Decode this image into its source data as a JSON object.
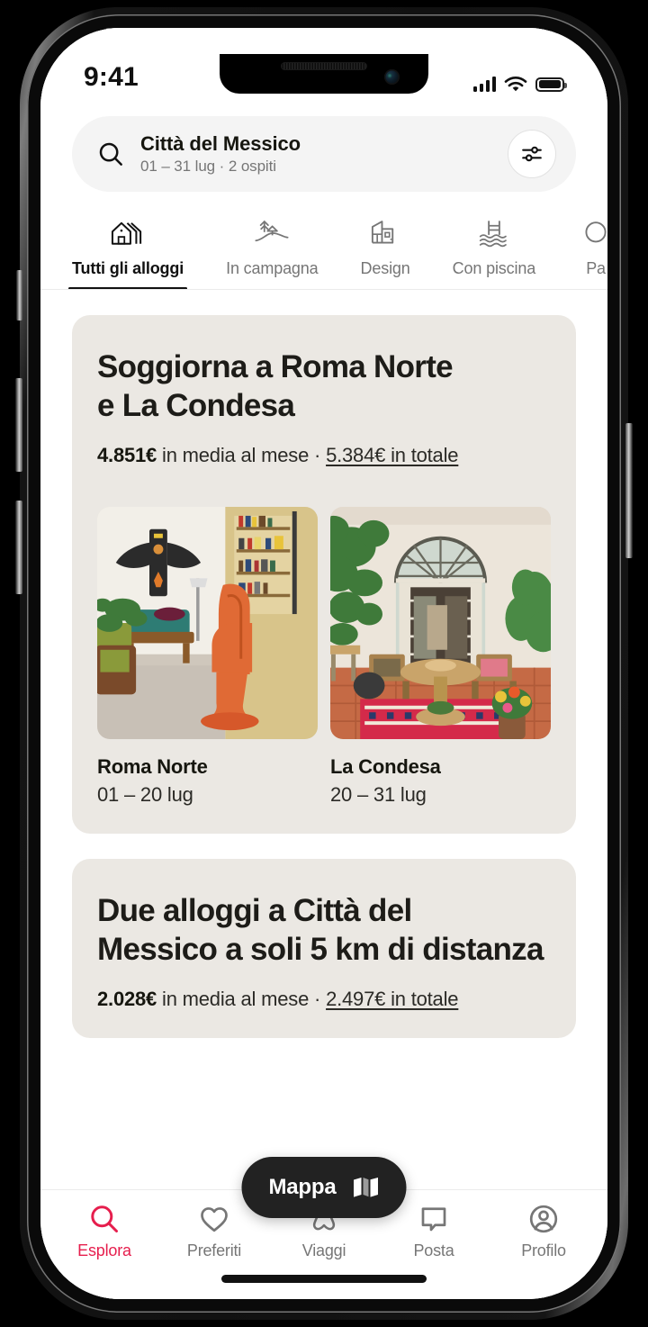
{
  "status_bar": {
    "time": "9:41",
    "signal_icon": "cellular-bars-icon",
    "wifi_icon": "wifi-icon",
    "battery_icon": "battery-full-icon"
  },
  "search": {
    "icon": "search-icon",
    "location": "Città del Messico",
    "details": "01 – 31 lug · 2 ospiti",
    "filter_icon": "filter-sliders-icon"
  },
  "categories": [
    {
      "label": "Tutti gli alloggi",
      "icon": "houses-icon",
      "active": true
    },
    {
      "label": "In campagna",
      "icon": "countryside-icon",
      "active": false
    },
    {
      "label": "Design",
      "icon": "design-building-icon",
      "active": false
    },
    {
      "label": "Con piscina",
      "icon": "pool-icon",
      "active": false
    },
    {
      "label": "Pa",
      "icon": "partial-category-icon",
      "active": false
    }
  ],
  "cards": [
    {
      "title": "Soggiorna a Roma Norte\ne La Condesa",
      "price_amount": "4.851€",
      "price_middle": " in media al mese · ",
      "price_total": "5.384€ in totale",
      "stays": [
        {
          "name": "Roma Norte",
          "dates": "01 – 20 lug",
          "photo": "living-room-orange-chair-photo"
        },
        {
          "name": "La Condesa",
          "dates": "20 – 31 lug",
          "photo": "courtyard-arched-doors-photo"
        }
      ]
    },
    {
      "title": "Due alloggi a Città del\nMessico a soli 5 km di distanza",
      "price_amount": "2.028€",
      "price_middle": " in media al mese · ",
      "price_total": "2.497€ in totale",
      "stays": []
    }
  ],
  "map_pill": {
    "label": "Mappa",
    "icon": "map-folded-icon"
  },
  "bottom_nav": [
    {
      "label": "Esplora",
      "icon": "search-icon",
      "active": true
    },
    {
      "label": "Preferiti",
      "icon": "heart-icon",
      "active": false
    },
    {
      "label": "Viaggi",
      "icon": "airbnb-logo-icon",
      "active": false
    },
    {
      "label": "Posta",
      "icon": "message-icon",
      "active": false
    },
    {
      "label": "Profilo",
      "icon": "person-circle-icon",
      "active": false
    }
  ],
  "colors": {
    "accent": "#e61e4d",
    "card_bg": "#ebe8e3",
    "pill_bg": "#222222",
    "text_primary": "#16160f",
    "text_muted": "#767676"
  }
}
